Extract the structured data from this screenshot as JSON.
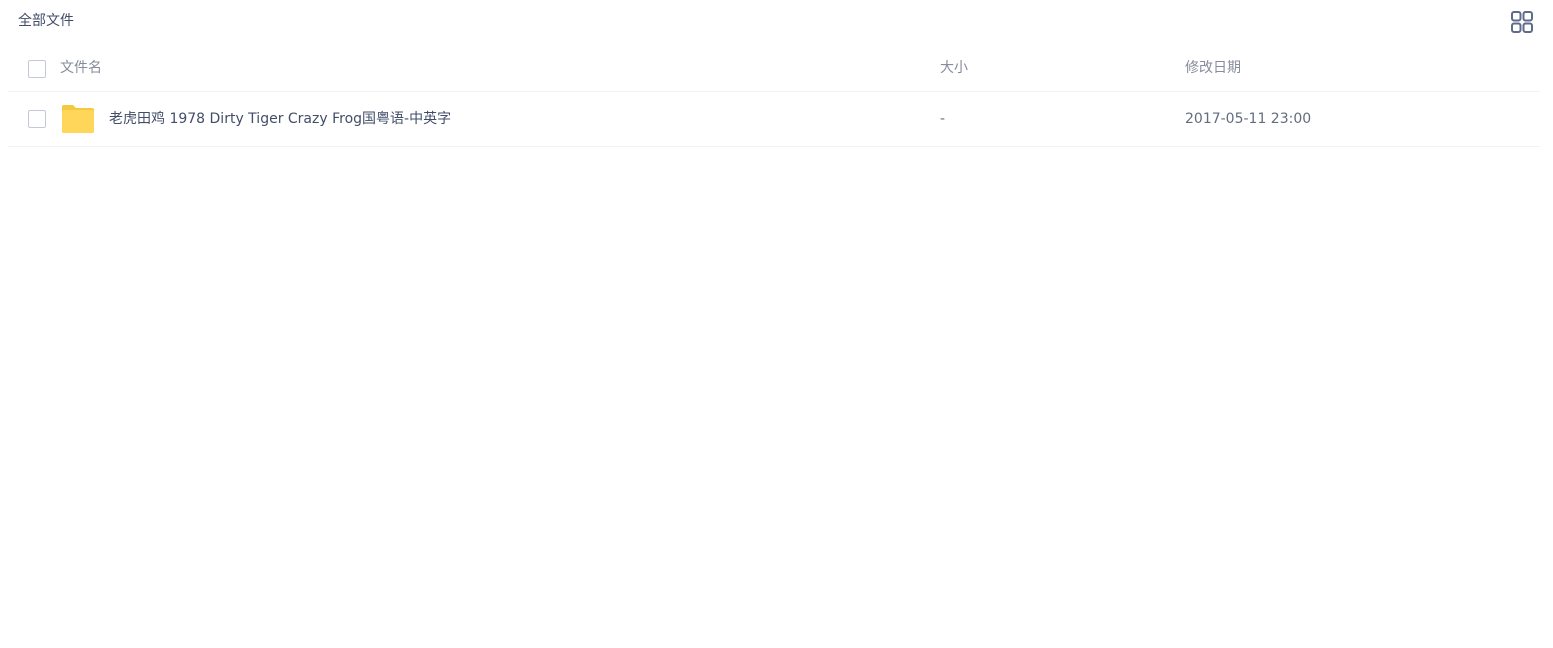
{
  "header": {
    "breadcrumb": "全部文件",
    "view_toggle_icon": "grid-view-icon"
  },
  "table": {
    "columns": {
      "name": "文件名",
      "size": "大小",
      "modified": "修改日期"
    },
    "rows": [
      {
        "icon": "folder-icon",
        "name": "老虎田鸡 1978 Dirty Tiger Crazy Frog国粤语-中英字",
        "size": "-",
        "modified": "2017-05-11 23:00"
      }
    ]
  },
  "colors": {
    "text": "#424e67",
    "muted": "#878c9c",
    "folder": "#ffd659",
    "icon": "#5f6b8a"
  }
}
